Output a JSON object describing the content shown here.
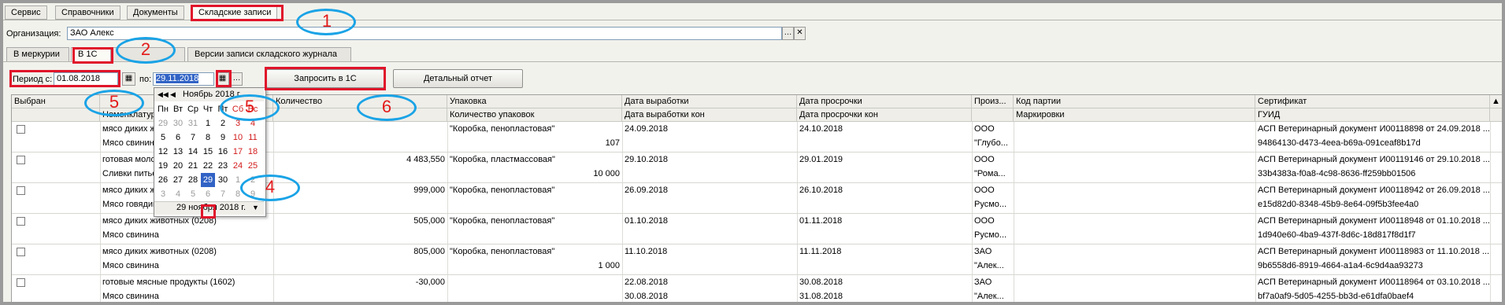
{
  "menu_tabs": [
    "Сервис",
    "Справочники",
    "Документы",
    "Складские записи"
  ],
  "org": {
    "label": "Организация:",
    "value": "ЗАО  Алекс"
  },
  "sub_tabs": [
    "В меркурии",
    "В 1С",
    "Версии записи складского журнала"
  ],
  "period": {
    "from_label": "Период с:",
    "from_value": "01.08.2018",
    "to_label": "по:",
    "to_value": "29.11.2018"
  },
  "buttons": {
    "request": "Запросить в 1С",
    "report": "Детальный отчет"
  },
  "callouts": [
    "1",
    "2",
    "5",
    "5",
    "6",
    "4"
  ],
  "calendar": {
    "month": "Ноябрь 2018 г.",
    "weekdays": [
      "Пн",
      "Вт",
      "Ср",
      "Чт",
      "Пт",
      "Сб",
      "Вс"
    ],
    "weeks": [
      [
        "29",
        "30",
        "31",
        "1",
        "2",
        "3",
        "4"
      ],
      [
        "5",
        "6",
        "7",
        "8",
        "9",
        "10",
        "11"
      ],
      [
        "12",
        "13",
        "14",
        "15",
        "16",
        "17",
        "18"
      ],
      [
        "19",
        "20",
        "21",
        "22",
        "23",
        "24",
        "25"
      ],
      [
        "26",
        "27",
        "28",
        "29",
        "30",
        "1",
        "2"
      ],
      [
        "3",
        "4",
        "5",
        "6",
        "7",
        "8",
        "9"
      ]
    ],
    "footer": "29 ноября 2018 г."
  },
  "columns": {
    "top": [
      "Выбран",
      "",
      "Количество",
      "Упаковка",
      "Дата выработки",
      "Дата просрочки",
      "Произ...",
      "Код партии",
      "Сертификат"
    ],
    "bottom": [
      "",
      "Номенклатура",
      "",
      "Количество упаковок",
      "Дата выработки кон",
      "Дата просрочки кон",
      "",
      "Маркировки",
      "ГУИД"
    ]
  },
  "rows": [
    {
      "name1": "мясо диких животных (0208)",
      "name2": "Мясо свинина",
      "qty": "",
      "pack": "\"Коробка, пенопластовая\"",
      "packs": "107",
      "prod": "24.09.2018",
      "prod_end": "",
      "exp": "24.10.2018",
      "exp_end": "",
      "maker1": "ООО",
      "maker2": "\"Глубо...",
      "cert": "АСП Ветеринарный документ И00118898 от 24.09.2018 ...",
      "guid": "94864130-d473-4eea-b69a-091ceaf8b17d"
    },
    {
      "name1": "готовая молочная продукция",
      "name2": "Сливки питьевые",
      "qty": "4 483,550",
      "pack": "\"Коробка, пластмассовая\"",
      "packs": "10 000",
      "prod": "29.10.2018",
      "prod_end": "",
      "exp": "29.01.2019",
      "exp_end": "",
      "maker1": "ООО",
      "maker2": "\"Рома...",
      "cert": "АСП Ветеринарный документ И00119146 от 29.10.2018 ...",
      "guid": "33b4383a-f0a8-4c98-8636-ff259bb01506"
    },
    {
      "name1": "мясо диких животных (0208)",
      "name2": "Мясо говядина",
      "qty": "999,000",
      "pack": "\"Коробка, пенопластовая\"",
      "packs": "",
      "prod": "26.09.2018",
      "prod_end": "",
      "exp": "26.10.2018",
      "exp_end": "",
      "maker1": "ООО",
      "maker2": "Русмо...",
      "cert": "АСП Ветеринарный документ И00118942 от 26.09.2018 ...",
      "guid": "e15d82d0-8348-45b9-8e64-09f5b3fee4a0"
    },
    {
      "name1": "мясо диких животных (0208)",
      "name2": "Мясо свинина",
      "qty": "505,000",
      "pack": "\"Коробка, пенопластовая\"",
      "packs": "",
      "prod": "01.10.2018",
      "prod_end": "",
      "exp": "01.11.2018",
      "exp_end": "",
      "maker1": "ООО",
      "maker2": "Русмо...",
      "cert": "АСП Ветеринарный документ И00118948 от 01.10.2018 ...",
      "guid": "1d940e60-4ba9-437f-8d6c-18d817f8d1f7"
    },
    {
      "name1": "мясо диких животных (0208)",
      "name2": "Мясо свинина",
      "qty": "805,000",
      "pack": "\"Коробка, пенопластовая\"",
      "packs": "1 000",
      "prod": "11.10.2018",
      "prod_end": "",
      "exp": "11.11.2018",
      "exp_end": "",
      "maker1": "ЗАО",
      "maker2": "\"Алек...",
      "cert": "АСП Ветеринарный документ И00118983 от 11.10.2018 ...",
      "guid": "9b6558d6-8919-4664-a1a4-6c9d4aa93273"
    },
    {
      "name1": "готовые мясные продукты (1602)",
      "name2": "Мясо свинина",
      "qty": "-30,000",
      "pack": "",
      "packs": "",
      "prod": "22.08.2018",
      "prod_end": "30.08.2018",
      "exp": "30.08.2018",
      "exp_end": "31.08.2018",
      "maker1": "ЗАО",
      "maker2": "\"Алек...",
      "cert": "АСП Ветеринарный документ И00118964 от 03.10.2018 ...",
      "guid": "bf7a0af9-5d05-4255-bb3d-e61dfa0baef4"
    }
  ],
  "colors": {
    "accent_red": "#e0142a",
    "callout_blue": "#1aa3e6",
    "selection": "#3163c5"
  }
}
